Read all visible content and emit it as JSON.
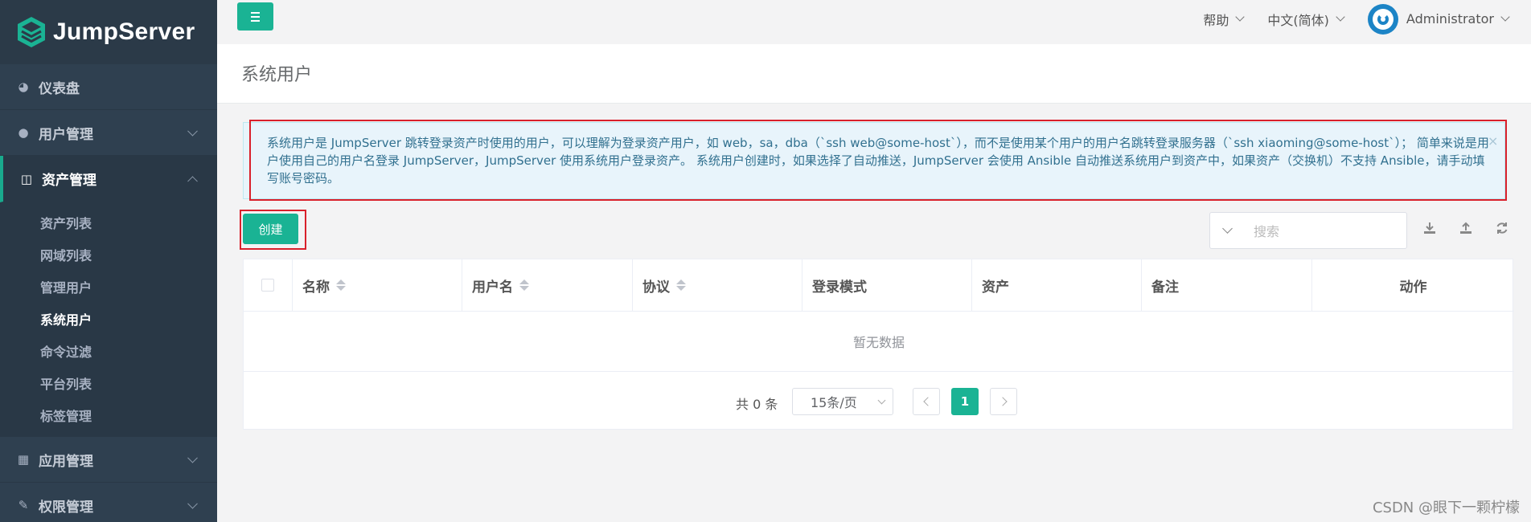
{
  "app": {
    "brand": "JumpServer"
  },
  "sidebar": {
    "items": [
      {
        "label": "仪表盘",
        "icon": "dashboard-icon"
      },
      {
        "label": "用户管理",
        "icon": "users-icon"
      },
      {
        "label": "资产管理",
        "icon": "inbox-icon"
      },
      {
        "label": "应用管理",
        "icon": "grid-icon"
      },
      {
        "label": "权限管理",
        "icon": "edit-icon"
      }
    ],
    "asset_sub": [
      "资产列表",
      "网域列表",
      "管理用户",
      "系统用户",
      "命令过滤",
      "平台列表",
      "标签管理"
    ],
    "active_sub": "系统用户"
  },
  "topbar": {
    "help": "帮助",
    "language": "中文(简体)",
    "user": "Administrator"
  },
  "page": {
    "title": "系统用户"
  },
  "alert": {
    "text": "系统用户是 JumpServer 跳转登录资产时使用的用户，可以理解为登录资产用户，如 web，sa，dba（`ssh web@some-host`），而不是使用某个用户的用户名跳转登录服务器（`ssh xiaoming@some-host`）； 简单来说是用户使用自己的用户名登录 JumpServer，JumpServer 使用系统用户登录资产。 系统用户创建时，如果选择了自动推送，JumpServer 会使用 Ansible 自动推送系统用户到资产中，如果资产（交换机）不支持 Ansible，请手动填写账号密码。",
    "close": "×"
  },
  "toolbar": {
    "create_label": "创建",
    "search_placeholder": "搜索"
  },
  "table": {
    "columns": [
      "名称",
      "用户名",
      "协议",
      "登录模式",
      "资产",
      "备注",
      "动作"
    ],
    "empty_text": "暂无数据"
  },
  "pagination": {
    "total": "共 0 条",
    "page_size": "15条/页",
    "current_page": "1"
  },
  "watermark": "CSDN @眼下一颗柠檬",
  "colors": {
    "accent": "#1ab394",
    "sidebar": "#2f4050",
    "highlight": "#d9202b"
  }
}
